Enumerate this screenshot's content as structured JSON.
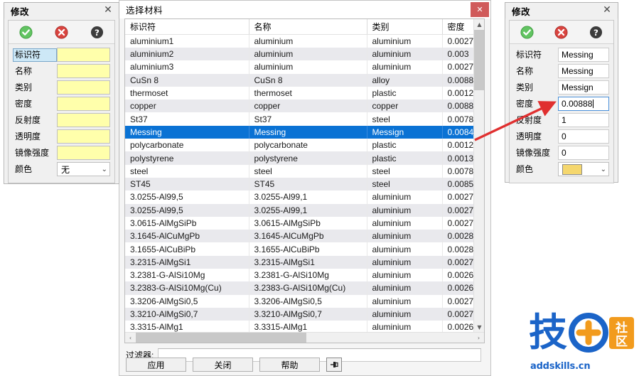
{
  "left_dialog": {
    "title": "修改",
    "close_label": "✕",
    "toolbar": {
      "ok_icon": "check-circle-icon",
      "cancel_icon": "cancel-circle-icon",
      "help_icon": "help-circle-icon"
    },
    "fields": [
      {
        "label": "标识符",
        "value": "",
        "type": "text",
        "selected": true
      },
      {
        "label": "名称",
        "value": "",
        "type": "text"
      },
      {
        "label": "类别",
        "value": "",
        "type": "text"
      },
      {
        "label": "密度",
        "value": "",
        "type": "text"
      },
      {
        "label": "反射度",
        "value": "",
        "type": "text"
      },
      {
        "label": "透明度",
        "value": "",
        "type": "text"
      },
      {
        "label": "镜像强度",
        "value": "",
        "type": "text"
      },
      {
        "label": "颜色",
        "value": "无",
        "type": "select"
      }
    ]
  },
  "right_dialog": {
    "title": "修改",
    "close_label": "✕",
    "toolbar": {
      "ok_icon": "check-circle-icon",
      "cancel_icon": "cancel-circle-icon",
      "help_icon": "help-circle-icon"
    },
    "fields": [
      {
        "label": "标识符",
        "value": "Messing",
        "type": "text"
      },
      {
        "label": "名称",
        "value": "Messing",
        "type": "text"
      },
      {
        "label": "类别",
        "value": "Messign",
        "type": "text"
      },
      {
        "label": "密度",
        "value": "0.00888",
        "type": "text",
        "focused": true
      },
      {
        "label": "反射度",
        "value": "1",
        "type": "text"
      },
      {
        "label": "透明度",
        "value": "0",
        "type": "text"
      },
      {
        "label": "镜像强度",
        "value": "0",
        "type": "text"
      },
      {
        "label": "颜色",
        "value": "",
        "type": "color",
        "swatch": "#f5d76e"
      }
    ]
  },
  "main_window": {
    "title": "选择材料",
    "close_label": "✕",
    "columns": [
      "标识符",
      "名称",
      "类别",
      "密度"
    ],
    "rows": [
      {
        "id": "aluminium1",
        "name": "aluminium",
        "category": "aluminium",
        "density": "0.0027"
      },
      {
        "id": "aluminium2",
        "name": "aluminium",
        "category": "aluminium",
        "density": "0.003"
      },
      {
        "id": "aluminium3",
        "name": "aluminium",
        "category": "aluminium",
        "density": "0.0027"
      },
      {
        "id": "CuSn 8",
        "name": "CuSn 8",
        "category": "alloy",
        "density": "0.0088"
      },
      {
        "id": "thermoset",
        "name": "thermoset",
        "category": "plastic",
        "density": "0.0012"
      },
      {
        "id": "copper",
        "name": "copper",
        "category": "copper",
        "density": "0.0088"
      },
      {
        "id": "St37",
        "name": "St37",
        "category": "steel",
        "density": "0.0078"
      },
      {
        "id": "Messing",
        "name": "Messing",
        "category": "Messign",
        "density": "0.0084",
        "selected": true
      },
      {
        "id": "polycarbonate",
        "name": "polycarbonate",
        "category": "plastic",
        "density": "0.0012"
      },
      {
        "id": "polystyrene",
        "name": "polystyrene",
        "category": "plastic",
        "density": "0.0013"
      },
      {
        "id": "steel",
        "name": "steel",
        "category": "steel",
        "density": "0.0078"
      },
      {
        "id": "ST45",
        "name": "ST45",
        "category": "steel",
        "density": "0.0085"
      },
      {
        "id": "3.0255-Al99,5",
        "name": "3.0255-Al99,1",
        "category": "aluminium",
        "density": "0.0027"
      },
      {
        "id": "3.0255-Al99,5",
        "name": "3.0255-Al99,1",
        "category": "aluminium",
        "density": "0.0027"
      },
      {
        "id": "3.0615-AlMgSiPb",
        "name": "3.0615-AlMgSiPb",
        "category": "aluminium",
        "density": "0.0027"
      },
      {
        "id": "3.1645-AlCuMgPb",
        "name": "3.1645-AlCuMgPb",
        "category": "aluminium",
        "density": "0.0028"
      },
      {
        "id": "3.1655-AlCuBiPb",
        "name": "3.1655-AlCuBiPb",
        "category": "aluminium",
        "density": "0.0028"
      },
      {
        "id": "3.2315-AlMgSi1",
        "name": "3.2315-AlMgSi1",
        "category": "aluminium",
        "density": "0.0027"
      },
      {
        "id": "3.2381-G-AlSi10Mg",
        "name": "3.2381-G-AlSi10Mg",
        "category": "aluminium",
        "density": "0.0026"
      },
      {
        "id": "3.2383-G-AlSi10Mg(Cu)",
        "name": "3.2383-G-AlSi10Mg(Cu)",
        "category": "aluminium",
        "density": "0.0026"
      },
      {
        "id": "3.3206-AlMgSi0,5",
        "name": "3.3206-AlMgSi0,5",
        "category": "aluminium",
        "density": "0.0027"
      },
      {
        "id": "3.3210-AlMgSi0,7",
        "name": "3.3210-AlMgSi0,7",
        "category": "aluminium",
        "density": "0.0027"
      },
      {
        "id": "3.3315-AlMg1",
        "name": "3.3315-AlMg1",
        "category": "aluminium",
        "density": "0.0026"
      }
    ],
    "scroll": {
      "up_arrow": "▲",
      "down_arrow": "▼",
      "left_arrow": "‹",
      "right_arrow": "›"
    },
    "filter": {
      "label": "过滤器:",
      "value": "",
      "placeholder": ""
    },
    "buttons": [
      {
        "label": "应用",
        "name": "apply-button"
      },
      {
        "label": "关闭",
        "name": "close-button"
      },
      {
        "label": "帮助",
        "name": "help-button"
      }
    ],
    "pin_button_icon": "pin-icon"
  },
  "annotation": {
    "arrow_color": "#e03030"
  },
  "watermark": {
    "text": "技",
    "text2": "社区",
    "url": "addskills.cn",
    "blue": "#1b64c8",
    "orange": "#f29b1d"
  }
}
